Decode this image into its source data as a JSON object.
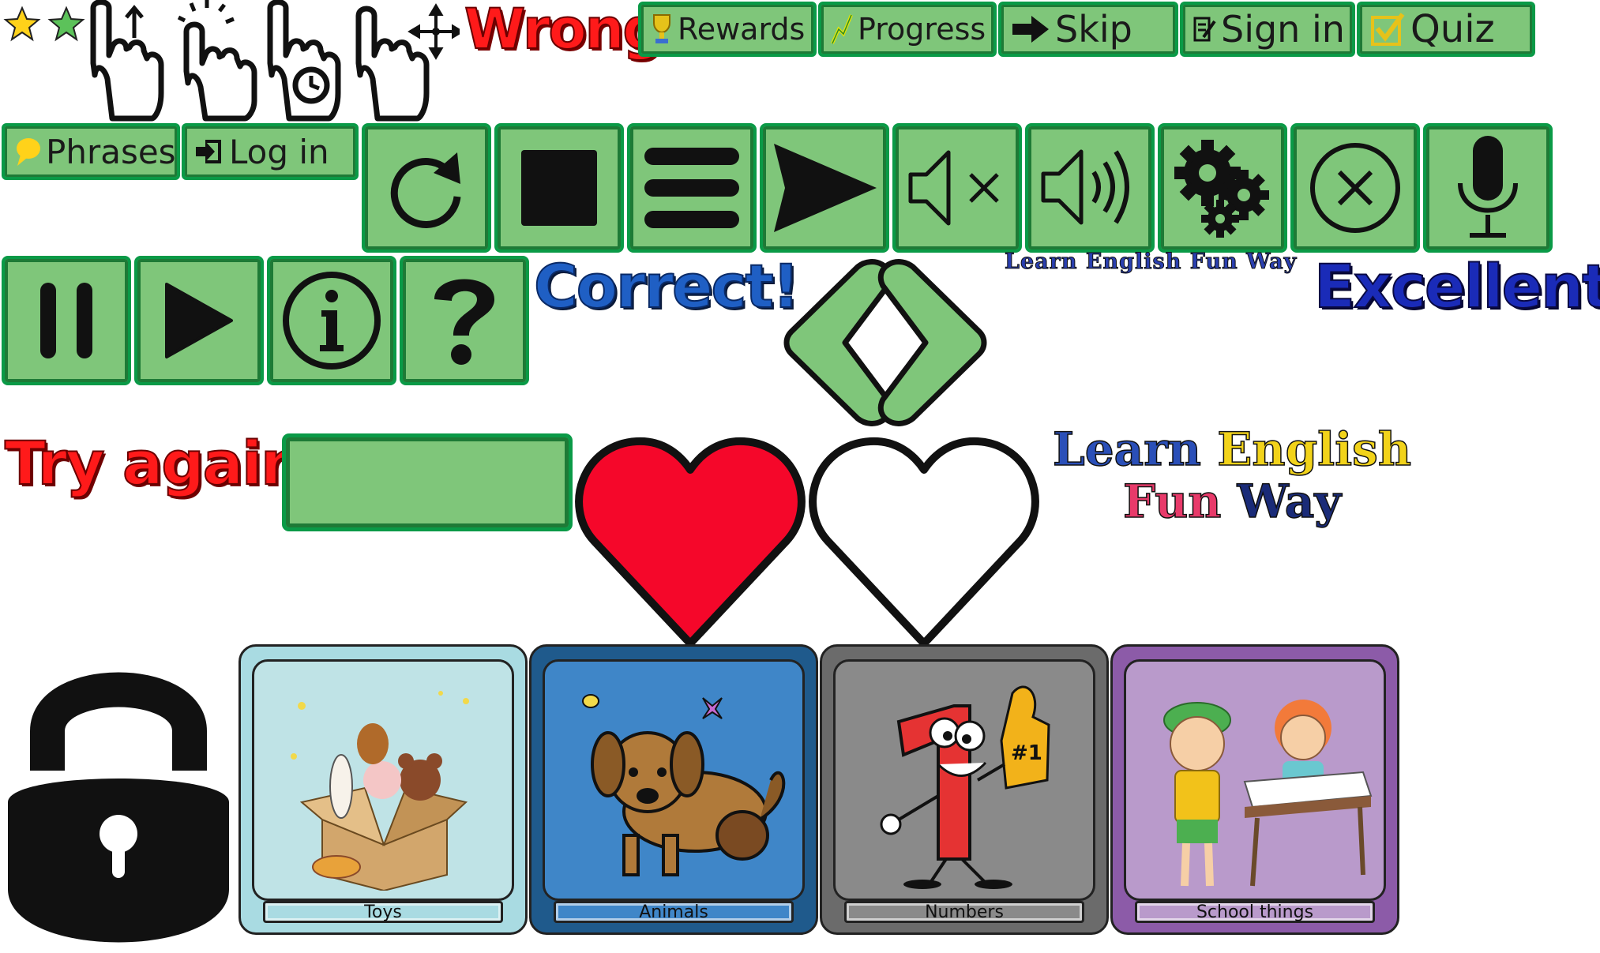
{
  "stars": {
    "count": 2
  },
  "feedback": {
    "wrong": "Wrong!",
    "correct": "Correct!",
    "excellent": "Excellent!",
    "try_again": "Try again!"
  },
  "top_buttons": {
    "rewards": "Rewards",
    "progress": "Progress",
    "skip": "Skip",
    "sign_in": "Sign in",
    "quiz": "Quiz",
    "phrases": "Phrases",
    "log_in": "Log in"
  },
  "logo": {
    "small": "Learn English Fun Way",
    "line1_a": "Learn",
    "line1_b": "English",
    "line2_a": "Fun",
    "line2_b": "Way"
  },
  "categories": [
    {
      "label": "Toys",
      "color": "#a9dbe2",
      "inner": "#bfe3e6"
    },
    {
      "label": "Animals",
      "color": "#1f5a8c",
      "inner": "#3f86c8"
    },
    {
      "label": "Numbers",
      "color": "#6b6b6b",
      "inner": "#8a8a8a"
    },
    {
      "label": "School things",
      "color": "#8c5ba8",
      "inner": "#b99acb"
    }
  ],
  "colors": {
    "button_fill": "#7fc67a",
    "button_border": "#0a9a47",
    "heart_red": "#f5072a",
    "wrong_red": "#ff1a1a",
    "correct_blue": "#1f5fc4",
    "excellent_blue": "#1a2bb8"
  },
  "icons": [
    "reload-icon",
    "stop-icon",
    "menu-icon",
    "send-icon",
    "mute-icon",
    "volume-icon",
    "settings-icon",
    "close-icon",
    "microphone-icon",
    "pause-icon",
    "play-icon",
    "info-icon",
    "help-icon",
    "lock-icon",
    "heart-full-icon",
    "heart-empty-icon"
  ]
}
